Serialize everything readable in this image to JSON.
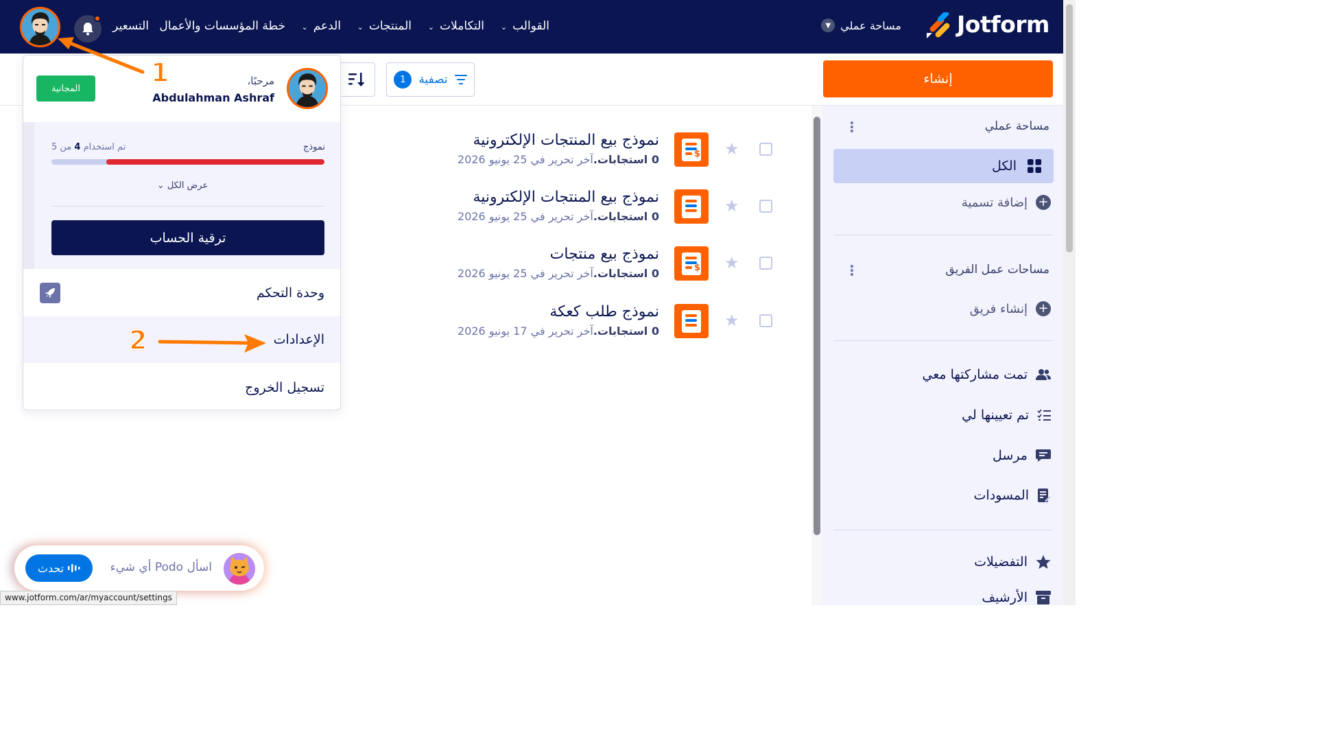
{
  "header": {
    "logo_text": "Jotform",
    "workspace_link": "مساحة عملي",
    "nav": [
      {
        "label": "القوالب",
        "has_chevron": true
      },
      {
        "label": "التكاملات",
        "has_chevron": true
      },
      {
        "label": "المنتجات",
        "has_chevron": true
      },
      {
        "label": "الدعم",
        "has_chevron": true
      },
      {
        "label": "خطة المؤسسات والأعمال",
        "has_chevron": false
      },
      {
        "label": "التسعير",
        "has_chevron": false
      }
    ],
    "notification_icon": "bell-icon"
  },
  "toolbar": {
    "create_label": "إنشاء",
    "filter_label": "تصفية",
    "filter_count": "1"
  },
  "sidebar": {
    "my_workspace": "مساحة عملي",
    "all_label": "الكل",
    "add_label": "إضافة تسمية",
    "team_workspaces": "مساحات عمل الفريق",
    "create_team": "إنشاء فريق",
    "items": [
      {
        "label": "تمت مشاركتها معي",
        "icon": "users-icon"
      },
      {
        "label": "تم تعيينها لي",
        "icon": "list-check-icon"
      },
      {
        "label": "مرسل",
        "icon": "message-icon"
      },
      {
        "label": "المسودات",
        "icon": "draft-icon"
      },
      {
        "label": "التفضيلات",
        "icon": "star-icon"
      },
      {
        "label": "الأرشيف",
        "icon": "archive-icon"
      }
    ]
  },
  "forms": [
    {
      "title": "نموذج بيع المنتجات الإلكترونية",
      "responses": "0 استجابات.",
      "edited": "آخر تحرير في 25 يونيو 2026",
      "payment": true
    },
    {
      "title": "نموذج بيع المنتجات الإلكترونية",
      "responses": "0 استجابات.",
      "edited": "آخر تحرير في 25 يونيو 2026",
      "payment": false
    },
    {
      "title": "نموذج بيع منتجات",
      "responses": "0 استجابات.",
      "edited": "آخر تحرير في 25 يونيو 2026",
      "payment": true
    },
    {
      "title": "نموذج طلب كعكة",
      "responses": "0 استجابات.",
      "edited": "آخر تحرير في 17 يونيو 2026",
      "payment": false
    }
  ],
  "account_menu": {
    "greeting": "مرحبًا،",
    "user_name": "Abdulahman Ashraf",
    "plan_badge": "المجانية",
    "usage_label": "نموذج",
    "usage_text_prefix": "تم استخدام",
    "usage_used": "4",
    "usage_text_suffix": "من 5",
    "usage_fraction": 0.8,
    "view_all": "عرض الكل",
    "upgrade_label": "ترقية الحساب",
    "dashboard_label": "وحدة التحكم",
    "settings_label": "الإعدادات",
    "logout_label": "تسجيل الخروج"
  },
  "annotations": {
    "step1": "1",
    "step2": "2"
  },
  "podo": {
    "prompt": "اسأل Podo أي شيء",
    "talk_label": "تحدث"
  },
  "status_url": "www.jotform.com/ar/myaccount/settings",
  "colors": {
    "navy": "#0a1551",
    "orange": "#ff6100",
    "blue": "#0075e3",
    "green": "#18b563",
    "red": "#e0282f"
  }
}
